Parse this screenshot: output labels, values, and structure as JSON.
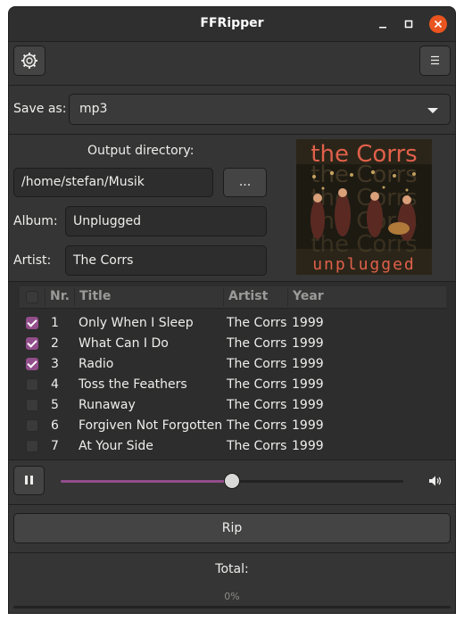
{
  "window": {
    "title": "FFRipper"
  },
  "save_as": {
    "label": "Save as:",
    "value": "mp3"
  },
  "output": {
    "label": "Output directory:",
    "path": "/home/stefan/Musik",
    "browse_label": "..."
  },
  "album": {
    "label": "Album:",
    "value": "Unplugged"
  },
  "artist": {
    "label": "Artist:",
    "value": "The Corrs"
  },
  "cover": {
    "top_text": "the Corrs",
    "bottom_text": "unplugged"
  },
  "tracklist": {
    "columns": [
      "Nr.",
      "Title",
      "Artist",
      "Year"
    ],
    "rows": [
      {
        "checked": true,
        "nr": "1",
        "title": "Only When I Sleep",
        "artist": "The Corrs",
        "year": "1999"
      },
      {
        "checked": true,
        "nr": "2",
        "title": "What Can I Do",
        "artist": "The Corrs",
        "year": "1999"
      },
      {
        "checked": true,
        "nr": "3",
        "title": "Radio",
        "artist": "The Corrs",
        "year": "1999"
      },
      {
        "checked": false,
        "nr": "4",
        "title": "Toss the Feathers",
        "artist": "The Corrs",
        "year": "1999"
      },
      {
        "checked": false,
        "nr": "5",
        "title": "Runaway",
        "artist": "The Corrs",
        "year": "1999"
      },
      {
        "checked": false,
        "nr": "6",
        "title": "Forgiven Not Forgotten",
        "artist": "The Corrs",
        "year": "1999"
      },
      {
        "checked": false,
        "nr": "7",
        "title": "At Your Side",
        "artist": "The Corrs",
        "year": "1999"
      }
    ]
  },
  "player": {
    "position_fraction": 0.5
  },
  "rip": {
    "label": "Rip"
  },
  "total": {
    "label": "Total:",
    "progress_text": "0%",
    "progress_fraction": 0.0
  },
  "colors": {
    "accent": "#924d8b",
    "close_button": "#e95420",
    "background": "#353535"
  }
}
